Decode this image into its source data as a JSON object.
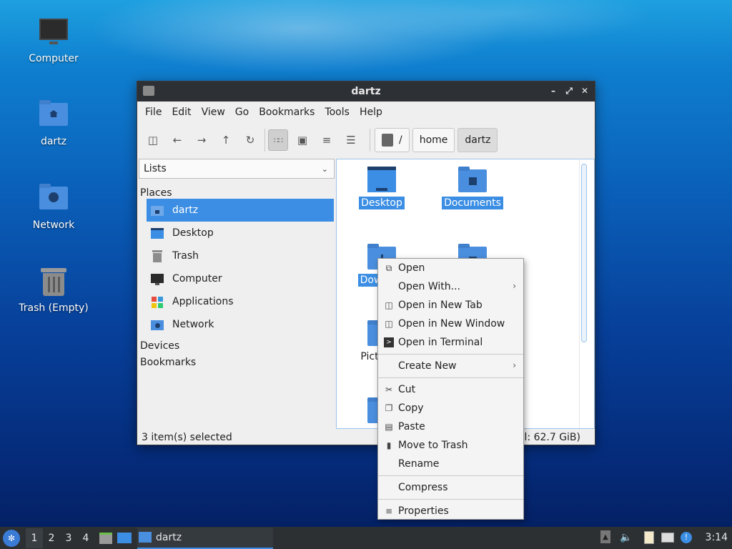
{
  "desktop": {
    "icons": [
      {
        "label": "Computer"
      },
      {
        "label": "dartz"
      },
      {
        "label": "Network"
      },
      {
        "label": "Trash (Empty)"
      }
    ]
  },
  "window": {
    "title": "dartz",
    "menu": [
      "File",
      "Edit",
      "View",
      "Go",
      "Bookmarks",
      "Tools",
      "Help"
    ],
    "path": [
      "/",
      "home",
      "dartz"
    ],
    "side_mode": "Lists",
    "places_header": "Places",
    "places": [
      {
        "label": "dartz",
        "icon": "home-folder-icon"
      },
      {
        "label": "Desktop",
        "icon": "desktop-icon"
      },
      {
        "label": "Trash",
        "icon": "trash-icon"
      },
      {
        "label": "Computer",
        "icon": "computer-icon"
      },
      {
        "label": "Applications",
        "icon": "applications-icon"
      },
      {
        "label": "Network",
        "icon": "network-icon"
      }
    ],
    "devices_header": "Devices",
    "bookmarks_header": "Bookmarks",
    "files": [
      {
        "label": "Desktop"
      },
      {
        "label": "Documents"
      },
      {
        "label": "Dow"
      },
      {
        "label": "Pict"
      }
    ],
    "status_left": "3 item(s) selected",
    "status_right": "al: 62.7 GiB)"
  },
  "context_menu": {
    "items": {
      "open": "Open",
      "open_with": "Open With...",
      "open_new_tab": "Open in New Tab",
      "open_new_window": "Open in New Window",
      "open_terminal": "Open in Terminal",
      "create_new": "Create New",
      "cut": "Cut",
      "copy": "Copy",
      "paste": "Paste",
      "move_to_trash": "Move to Trash",
      "rename": "Rename",
      "compress": "Compress",
      "properties": "Properties"
    }
  },
  "taskbar": {
    "workspaces": [
      "1",
      "2",
      "3",
      "4"
    ],
    "task_label": "dartz",
    "clock": "3:14"
  },
  "colors": {
    "selection": "#3b8ee4",
    "folder": "#4a8fdf",
    "titlebar": "#2d3136"
  }
}
